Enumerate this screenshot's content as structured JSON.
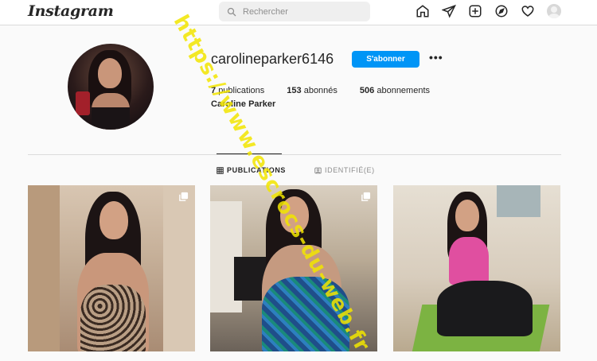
{
  "app": {
    "logo": "Instagram"
  },
  "search": {
    "placeholder": "Rechercher"
  },
  "nav": {
    "icons": [
      "home-icon",
      "direct-message-icon",
      "new-post-icon",
      "explore-icon",
      "activity-heart-icon",
      "profile-avatar-icon"
    ]
  },
  "profile": {
    "username": "carolineparker6146",
    "follow_label": "S'abonner",
    "more_label": "•••",
    "publications_count": "7",
    "publications_label": "publications",
    "followers_count": "153",
    "followers_label": "abonnés",
    "following_count": "506",
    "following_label": "abonnements",
    "full_name": "Caroline Parker"
  },
  "tabs": {
    "publications": "PUBLICATIONS",
    "tagged": "IDENTIFIÉ(E)"
  },
  "watermark": {
    "text": "https://www.escrocs-du-web.fr"
  },
  "colors": {
    "accent": "#0095f6",
    "watermark": "#f2e600"
  }
}
